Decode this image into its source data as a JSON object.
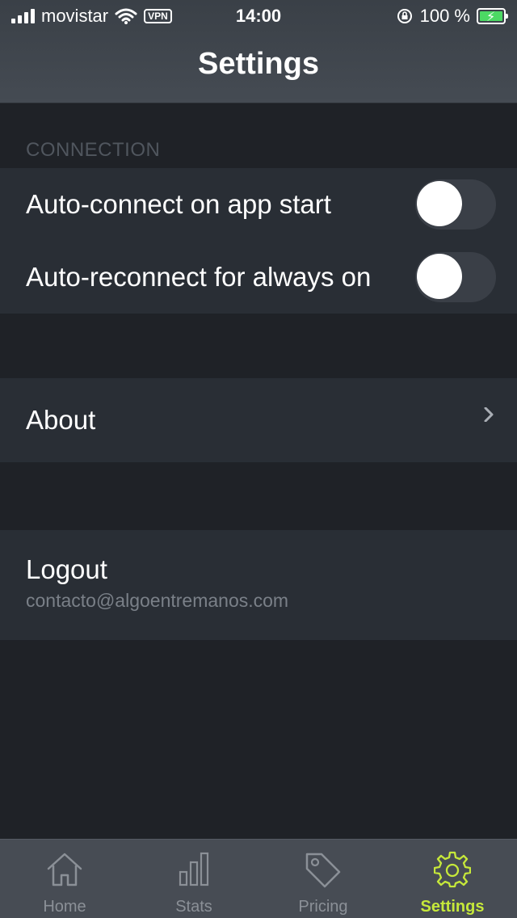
{
  "status_bar": {
    "carrier": "movistar",
    "vpn": "VPN",
    "time": "14:00",
    "battery": "100 %",
    "icons": [
      "signal-icon",
      "wifi-icon",
      "vpn-icon",
      "orientation-lock-icon",
      "battery-charging-icon"
    ]
  },
  "nav": {
    "title": "Settings"
  },
  "connection": {
    "header": "CONNECTION",
    "auto_connect": {
      "label": "Auto-connect on app start",
      "enabled": false
    },
    "auto_reconnect": {
      "label": "Auto-reconnect for always on",
      "enabled": false
    }
  },
  "about": {
    "label": "About",
    "icon": "chevron-right-icon"
  },
  "logout": {
    "label": "Logout",
    "email": "contacto@algoentremanos.com"
  },
  "tabbar": {
    "tabs": [
      {
        "label": "Home",
        "icon": "home-icon"
      },
      {
        "label": "Stats",
        "icon": "bar-chart-icon"
      },
      {
        "label": "Pricing",
        "icon": "tag-icon"
      },
      {
        "label": "Settings",
        "icon": "gear-icon",
        "active": true
      }
    ]
  },
  "colors": {
    "background": "#1f2227",
    "row_background": "#292e35",
    "accent": "#c6e83a",
    "section_header": "#50565e"
  }
}
